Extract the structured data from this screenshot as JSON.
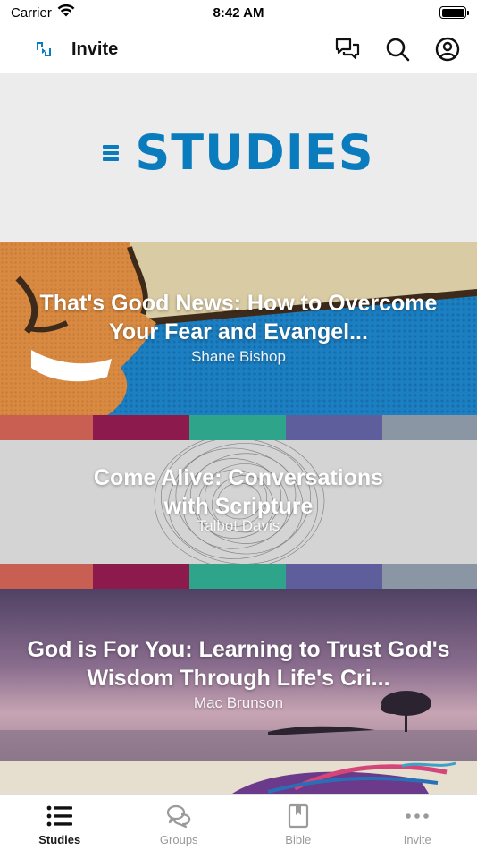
{
  "status_bar": {
    "carrier": "Carrier",
    "time": "8:42 AM",
    "battery_level": 1.0
  },
  "nav": {
    "title": "Invite",
    "icons": [
      "chat-bubbles-icon",
      "search-icon",
      "profile-icon"
    ]
  },
  "hero": {
    "title": "STUDIES",
    "color": "#0a7bbd"
  },
  "studies": [
    {
      "title": "That's Good News: How to Overcome Your Fear and Evangel...",
      "author": "Shane Bishop"
    },
    {
      "title": "Come Alive: Conversations with Scripture",
      "author": "Talbot Davis"
    },
    {
      "title": "God is For You: Learning to Trust God's Wisdom Through Life's Cri...",
      "author": "Mac Brunson"
    }
  ],
  "tab_bar": {
    "active": "Studies",
    "tabs": [
      {
        "label": "Studies",
        "icon": "list-icon"
      },
      {
        "label": "Groups",
        "icon": "groups-chat-icon"
      },
      {
        "label": "Bible",
        "icon": "bible-icon"
      },
      {
        "label": "Invite",
        "icon": "more-dots-icon"
      }
    ]
  },
  "colors": {
    "stripe": [
      "#c95f52",
      "#8d1a4d",
      "#2ea58b",
      "#5e5e9c",
      "#8a96a3"
    ]
  }
}
